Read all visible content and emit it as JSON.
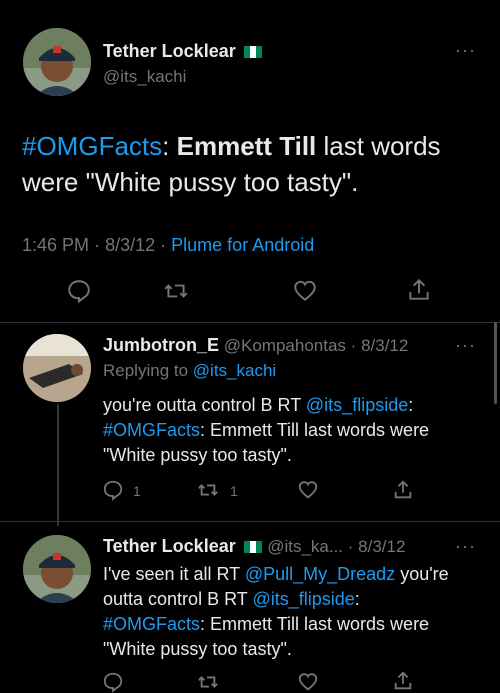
{
  "main_tweet": {
    "author_name": "Tether Locklear",
    "handle": "@its_kachi",
    "hashtag": "#OMGFacts",
    "text_colon": ":",
    "bold_name": "Emmett Till",
    "text_rest_line1": "last words",
    "text_line2": "were \"White pussy too tasty\".",
    "time": "1:46 PM",
    "sep1": "·",
    "date": "8/3/12",
    "sep2": "·",
    "client": "Plume for Android"
  },
  "replies": [
    {
      "author_name": "Jumbotron_E",
      "handle": "@Kompahontas",
      "sep": "·",
      "date": "8/3/12",
      "replying_prefix": "Replying to",
      "replying_handle": "@its_kachi",
      "line1_prefix": "you're outta control B RT",
      "line1_mention": "@its_flipside",
      "line1_suffix": ":",
      "line2_hashtag": "#OMGFacts",
      "line2_rest": ": Emmett Till last words were",
      "line3": "\"White pussy too tasty\".",
      "reply_count": "1",
      "retweet_count": "1"
    },
    {
      "author_name": "Tether Locklear",
      "handle": "@its_ka...",
      "sep": "·",
      "date": "8/3/12",
      "line1_prefix": "I've seen it all RT",
      "line1_mention": "@Pull_My_Dreadz",
      "line1_suffix": "you're",
      "line2_prefix": "outta control B RT",
      "line2_mention": "@its_flipside",
      "line2_suffix": ":",
      "line3_hashtag": "#OMGFacts",
      "line3_rest": ": Emmett Till last words were",
      "line4": "\"White pussy too tasty\"."
    }
  ],
  "colors": {
    "background": "#000000",
    "link": "#1d9bf0",
    "muted": "#71767b",
    "text": "#e7e9ea",
    "flag_green": "#008751"
  }
}
